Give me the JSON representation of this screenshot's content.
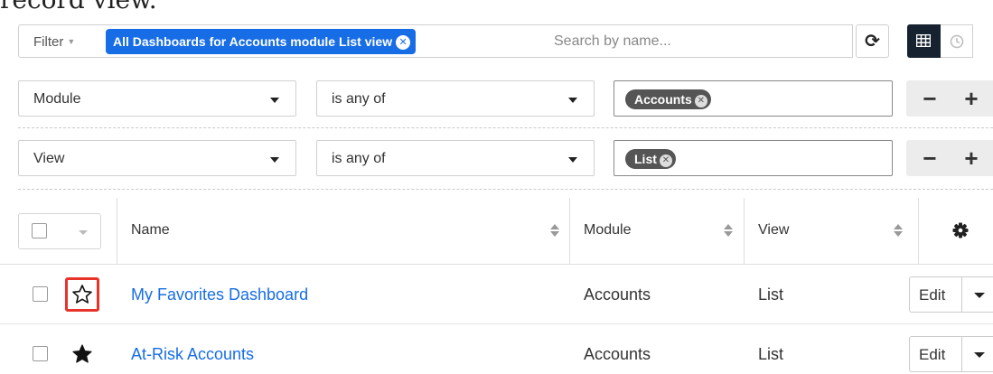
{
  "intro": {
    "text": "record view."
  },
  "filter_bar": {
    "filter_label": "Filter",
    "active_filter": "All Dashboards for Accounts module List view",
    "search_placeholder": "Search by name...",
    "icons": [
      "refresh-icon",
      "grid-icon",
      "clock-icon"
    ]
  },
  "filter_rows": [
    {
      "field": "Module",
      "operator": "is any of",
      "value": "Accounts"
    },
    {
      "field": "View",
      "operator": "is any of",
      "value": "List"
    }
  ],
  "row_buttons": {
    "remove": "−",
    "add": "+"
  },
  "table": {
    "columns": [
      "Name",
      "Module",
      "View"
    ],
    "rows": [
      {
        "favorite": false,
        "highlighted": true,
        "name": "My Favorites Dashboard",
        "module": "Accounts",
        "view": "List",
        "action": "Edit"
      },
      {
        "favorite": true,
        "highlighted": false,
        "name": "At-Risk Accounts",
        "module": "Accounts",
        "view": "List",
        "action": "Edit"
      }
    ]
  },
  "colors": {
    "accent": "#176de5",
    "highlight": "#e8322a",
    "active_view": "#16222f",
    "tag": "#555555"
  }
}
